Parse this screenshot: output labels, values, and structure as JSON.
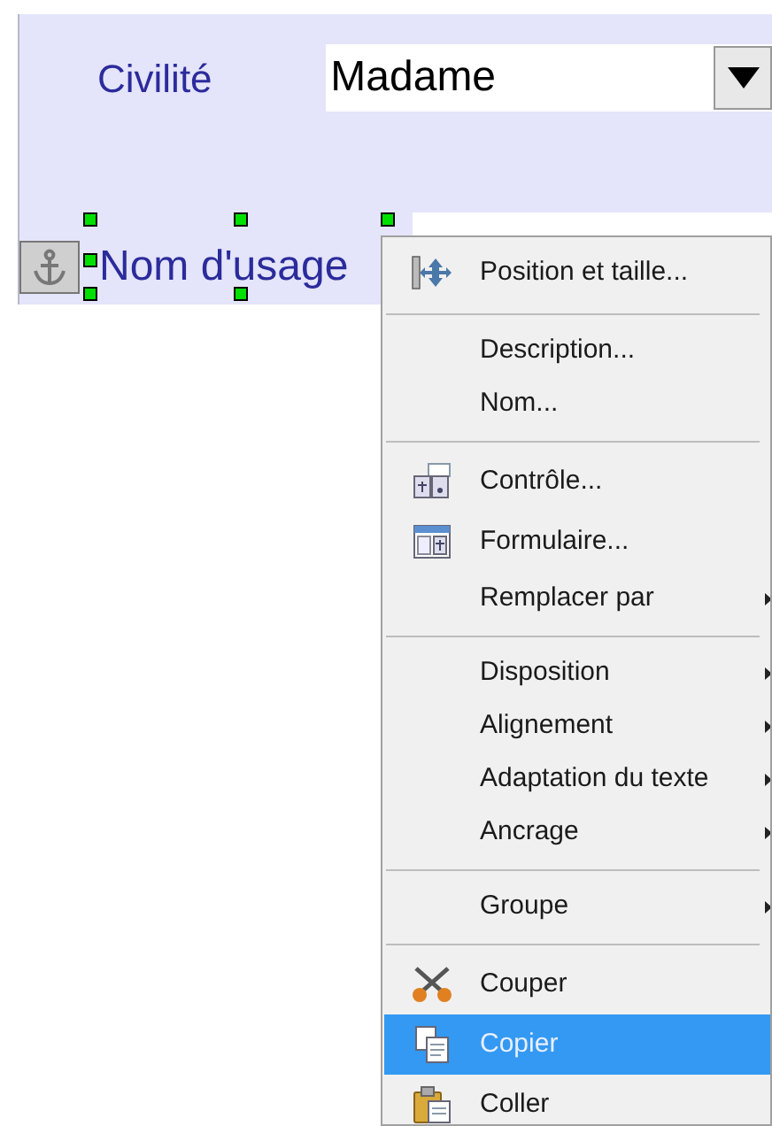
{
  "form": {
    "civilite": {
      "label": "Civilité",
      "value": "Madame"
    },
    "nom_usage": {
      "label": "Nom d'usage",
      "selected": true
    }
  },
  "context_menu": [
    {
      "kind": "item",
      "label": "Position et taille...",
      "submenu": false,
      "selected": false
    },
    {
      "kind": "separator"
    },
    {
      "kind": "item",
      "label": "Description...",
      "submenu": false,
      "selected": false
    },
    {
      "kind": "item",
      "label": "Nom...",
      "submenu": false,
      "selected": false
    },
    {
      "kind": "separator"
    },
    {
      "kind": "item",
      "label": "Contrôle...",
      "submenu": false,
      "selected": false
    },
    {
      "kind": "item",
      "label": "Formulaire...",
      "submenu": false,
      "selected": false
    },
    {
      "kind": "item",
      "label": "Remplacer par",
      "submenu": true,
      "selected": false
    },
    {
      "kind": "separator"
    },
    {
      "kind": "item",
      "label": "Disposition",
      "submenu": true,
      "selected": false
    },
    {
      "kind": "item",
      "label": "Alignement",
      "submenu": true,
      "selected": false
    },
    {
      "kind": "item",
      "label": "Adaptation du texte",
      "submenu": true,
      "selected": false
    },
    {
      "kind": "item",
      "label": "Ancrage",
      "submenu": true,
      "selected": false
    },
    {
      "kind": "separator"
    },
    {
      "kind": "item",
      "label": "Groupe",
      "submenu": true,
      "selected": false
    },
    {
      "kind": "separator"
    },
    {
      "kind": "item",
      "label": "Couper",
      "submenu": false,
      "selected": false
    },
    {
      "kind": "item",
      "label": "Copier",
      "submenu": false,
      "selected": true
    },
    {
      "kind": "item",
      "label": "Coller",
      "submenu": false,
      "selected": false
    }
  ]
}
